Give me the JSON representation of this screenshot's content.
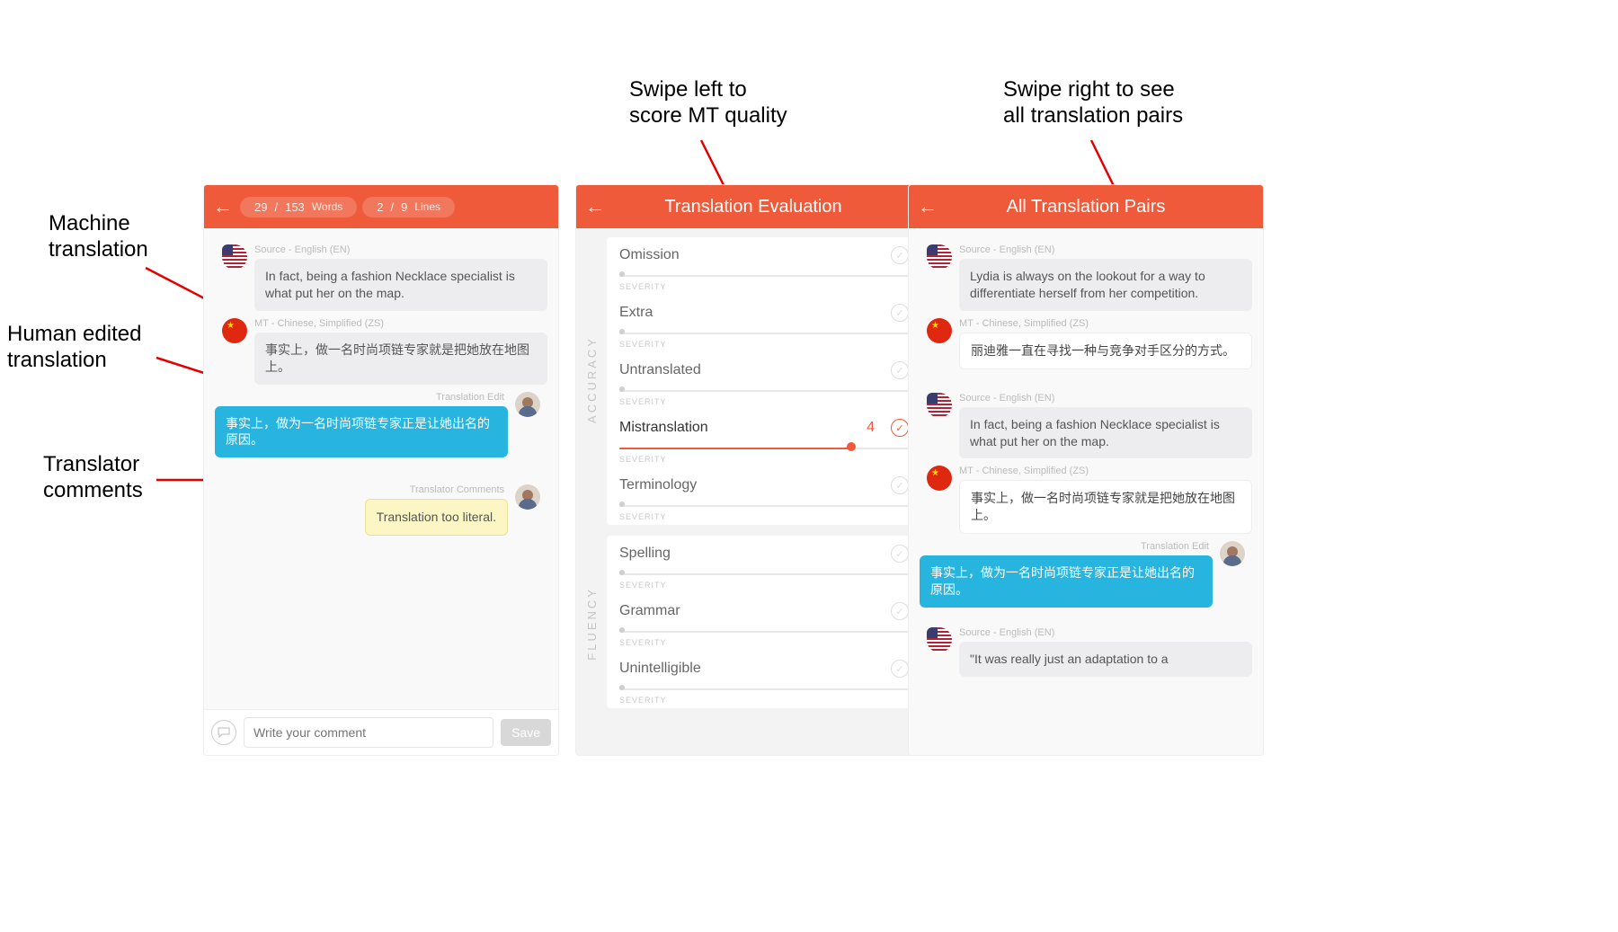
{
  "annotations": {
    "mt": "Machine\ntranslation",
    "edit": "Human edited\ntranslation",
    "comments": "Translator\ncomments",
    "swipeLeft": "Swipe left to\nscore MT quality",
    "swipeRight": "Swipe right to see\nall translation pairs"
  },
  "panel1": {
    "counterA": {
      "cur": "29",
      "sep": "/",
      "total": "153",
      "label": "Words"
    },
    "counterB": {
      "cur": "2",
      "sep": "/",
      "total": "9",
      "label": "Lines"
    },
    "src_label": "Source - English (EN)",
    "src_text": "In fact, being a fashion Necklace specialist is what put her on the map.",
    "mt_label": "MT - Chinese, Simplified (ZS)",
    "mt_text": "事实上，做一名时尚项链专家就是把她放在地图上。",
    "edit_label": "Translation Edit",
    "edit_text": "事实上，做为一名时尚项链专家正是让她出名的原因。",
    "cm_label": "Translator Comments",
    "cm_text": "Translation too literal.",
    "placeholder": "Write your comment",
    "save": "Save"
  },
  "panel2": {
    "title": "Translation Evaluation",
    "cat1": "ACCURACY",
    "cat2": "FLUENCY",
    "severity": "SEVERITY",
    "items1": [
      {
        "name": "Omission",
        "score": null,
        "pct": 0
      },
      {
        "name": "Extra",
        "score": null,
        "pct": 0
      },
      {
        "name": "Untranslated",
        "score": null,
        "pct": 0
      },
      {
        "name": "Mistranslation",
        "score": "4",
        "pct": 80
      },
      {
        "name": "Terminology",
        "score": null,
        "pct": 0
      }
    ],
    "items2": [
      {
        "name": "Spelling",
        "score": null,
        "pct": 0
      },
      {
        "name": "Grammar",
        "score": null,
        "pct": 0
      },
      {
        "name": "Unintelligible",
        "score": null,
        "pct": 0
      }
    ]
  },
  "panel3": {
    "title": "All Translation Pairs",
    "src_label": "Source - English (EN)",
    "mt_label": "MT - Chinese, Simplified (ZS)",
    "edit_label": "Translation Edit",
    "p1_src": "Lydia is always on the lookout for a way to differentiate herself from her competition.",
    "p1_mt": "丽迪雅一直在寻找一种与竞争对手区分的方式。",
    "p2_src": "In fact, being a fashion Necklace specialist is what put her on the map.",
    "p2_mt": "事实上，做一名时尚项链专家就是把她放在地图上。",
    "p2_edit": "事实上，做为一名时尚项链专家正是让她出名的原因。",
    "p3_src": "\"It was really just an adaptation to a"
  }
}
